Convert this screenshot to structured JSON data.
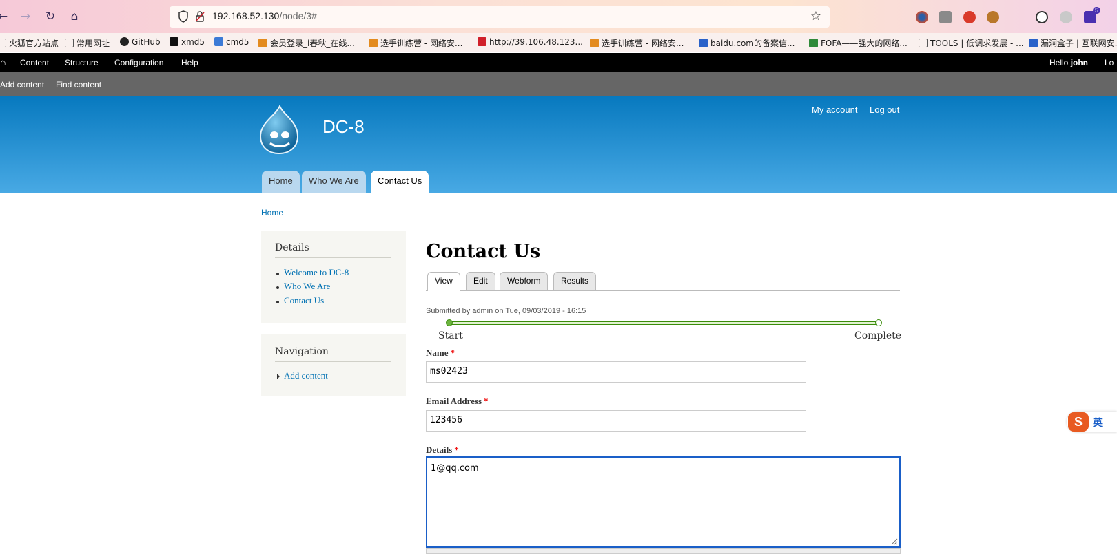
{
  "browser": {
    "url_host": "192.168.52.130",
    "url_path": "/node/3#",
    "notification_count": "5"
  },
  "bookmarks": [
    {
      "label": "火狐官方站点",
      "color": "#5f6bd9"
    },
    {
      "label": "常用网址",
      "color": "#5f6bd9"
    },
    {
      "label": "GitHub",
      "color": "#222222"
    },
    {
      "label": "xmd5",
      "color": "#111111"
    },
    {
      "label": "cmd5",
      "color": "#3b7ad6"
    },
    {
      "label": "会员登录_i春秋_在线...",
      "color": "#e38b1f"
    },
    {
      "label": "选手训练营 - 网络安...",
      "color": "#e38b1f"
    },
    {
      "label": "http://39.106.48.123...",
      "color": "#d0202a"
    },
    {
      "label": "选手训练营 - 网络安...",
      "color": "#e38b1f"
    },
    {
      "label": "baidu.com的备案信...",
      "color": "#2a62c9"
    },
    {
      "label": "FOFA——强大的网络...",
      "color": "#2f8a3a"
    },
    {
      "label": "TOOLS | 低调求发展 - ...",
      "color": "#555555"
    },
    {
      "label": "漏洞盒子 | 互联网安...",
      "color": "#2a62c9"
    }
  ],
  "admin_toolbar": {
    "home_icon": "home-icon",
    "items": [
      "Content",
      "Structure",
      "Configuration",
      "Help"
    ],
    "hello_prefix": "Hello ",
    "user": "john",
    "logout_partial": "Lo"
  },
  "shortcuts": {
    "add_content": "Add content",
    "find_content": "Find content"
  },
  "header": {
    "site_name": "DC-8",
    "my_account": "My account",
    "log_out": "Log out",
    "tabs": [
      "Home",
      "Who We Are",
      "Contact Us"
    ],
    "active_tab": "Contact Us"
  },
  "breadcrumb": "Home",
  "sidebar": {
    "details_title": "Details",
    "details_links": [
      "Welcome to DC-8",
      "Who We Are",
      "Contact Us"
    ],
    "navigation_title": "Navigation",
    "navigation_links": [
      "Add content"
    ]
  },
  "content": {
    "title": "Contact Us",
    "tabs": [
      "View",
      "Edit",
      "Webform",
      "Results"
    ],
    "active_tab": "View",
    "submitted": "Submitted by admin on Tue, 09/03/2019 - 16:15",
    "progress": {
      "start_label": "Start",
      "complete_label": "Complete",
      "fraction": 0
    }
  },
  "form": {
    "name_label": "Name",
    "name_value": "ms02423",
    "email_label": "Email Address",
    "email_value": "123456",
    "details_label": "Details",
    "details_value": "1@qq.com",
    "required_marker": "*"
  },
  "ime": {
    "logo": "S",
    "mode": "英"
  },
  "colors": {
    "header_top": "#0779bf",
    "header_bottom": "#48a9e4",
    "link": "#0071b3",
    "required": "#e00000",
    "progress_green": "#6cb43f",
    "focus_border": "#1a5fc8"
  }
}
